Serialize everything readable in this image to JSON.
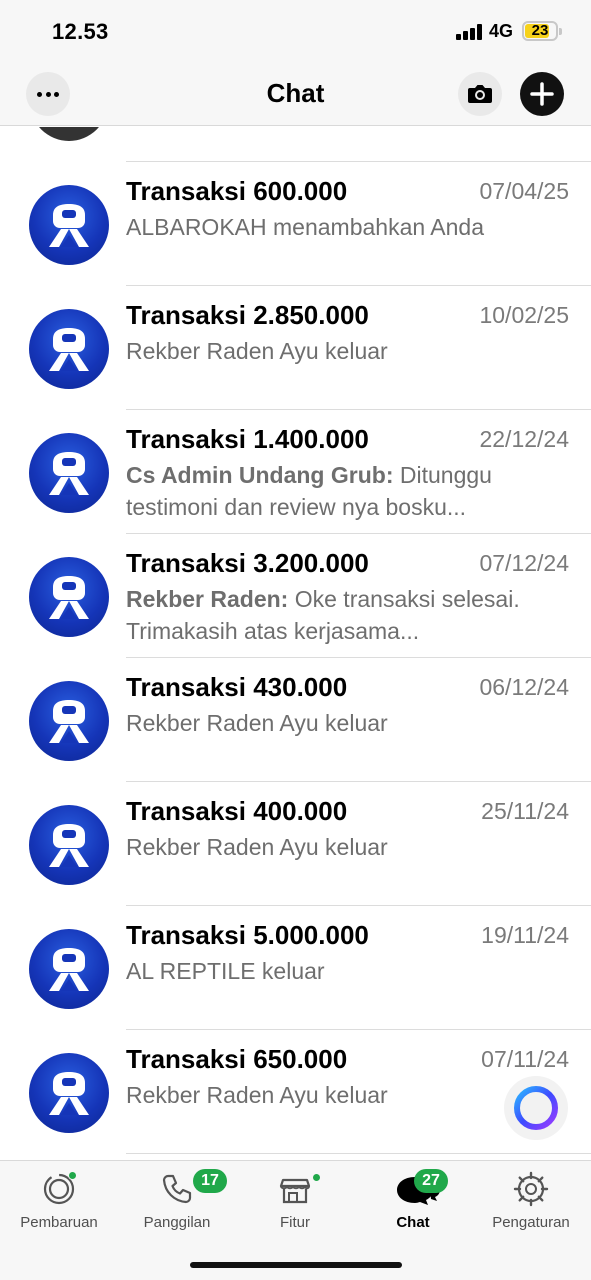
{
  "status_bar": {
    "time": "12.53",
    "network": "4G",
    "battery": "23",
    "battery_color": "#f7d21a"
  },
  "header": {
    "title": "Chat",
    "more_icon": "ellipsis-icon",
    "camera_icon": "camera-icon",
    "new_chat_icon": "plus-icon"
  },
  "chats": [
    {
      "name": "Transaksi 600.000",
      "date": "07/04/25",
      "sender": "",
      "message": "ALBAROKAH menambahkan Anda"
    },
    {
      "name": "Transaksi 2.850.000",
      "date": "10/02/25",
      "sender": "",
      "message": "Rekber Raden Ayu keluar"
    },
    {
      "name": "Transaksi 1.400.000",
      "date": "22/12/24",
      "sender": "Cs Admin Undang Grub",
      "message": "Ditunggu testimoni dan review nya bosku..."
    },
    {
      "name": "Transaksi 3.200.000",
      "date": "07/12/24",
      "sender": "Rekber Raden",
      "message": "Oke transaksi selesai. Trimakasih atas kerjasama..."
    },
    {
      "name": "Transaksi 430.000",
      "date": "06/12/24",
      "sender": "",
      "message": "Rekber Raden Ayu keluar"
    },
    {
      "name": "Transaksi 400.000",
      "date": "25/11/24",
      "sender": "",
      "message": "Rekber Raden Ayu keluar"
    },
    {
      "name": "Transaksi 5.000.000",
      "date": "19/11/24",
      "sender": "",
      "message": "AL REPTILE keluar"
    },
    {
      "name": "Transaksi 650.000",
      "date": "07/11/24",
      "sender": "",
      "message": "Rekber Raden Ayu keluar"
    }
  ],
  "tabs": [
    {
      "label": "Pembaruan",
      "icon": "status-updates-icon",
      "badge": "",
      "dot": true,
      "active": false
    },
    {
      "label": "Panggilan",
      "icon": "phone-icon",
      "badge": "17",
      "dot": false,
      "active": false
    },
    {
      "label": "Fitur",
      "icon": "store-icon",
      "badge": "",
      "dot": true,
      "active": false
    },
    {
      "label": "Chat",
      "icon": "chat-bubbles-icon",
      "badge": "27",
      "dot": false,
      "active": true
    },
    {
      "label": "Pengaturan",
      "icon": "gear-icon",
      "badge": "",
      "dot": false,
      "active": false
    }
  ],
  "colors": {
    "accent_green": "#20a84a",
    "avatar_blue": "#1535b8",
    "secondary_text": "#6e6e6e"
  }
}
